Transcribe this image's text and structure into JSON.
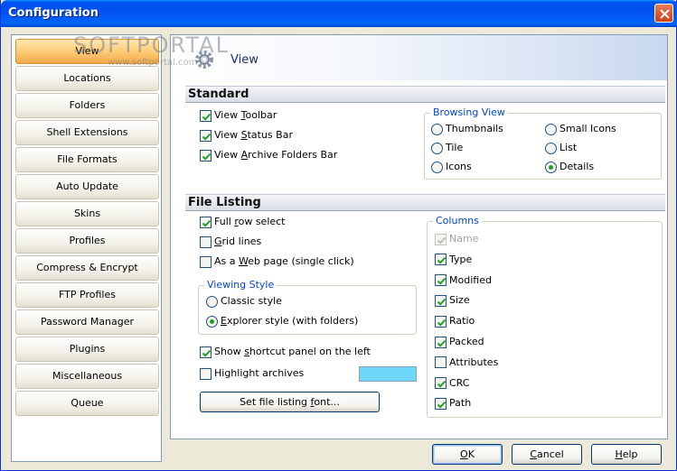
{
  "window": {
    "title": "Configuration"
  },
  "watermark": {
    "main": "SOFTPORTAL",
    "sub": "www.softportal.com"
  },
  "sidebar": {
    "items": [
      {
        "label": "View",
        "active": true
      },
      {
        "label": "Locations"
      },
      {
        "label": "Folders"
      },
      {
        "label": "Shell Extensions"
      },
      {
        "label": "File Formats"
      },
      {
        "label": "Auto Update"
      },
      {
        "label": "Skins"
      },
      {
        "label": "Profiles"
      },
      {
        "label": "Compress & Encrypt"
      },
      {
        "label": "FTP Profiles"
      },
      {
        "label": "Password Manager"
      },
      {
        "label": "Plugins"
      },
      {
        "label": "Miscellaneous"
      },
      {
        "label": "Queue"
      }
    ]
  },
  "page": {
    "title": "View"
  },
  "standard": {
    "header": "Standard",
    "options": [
      {
        "pre": "View ",
        "key": "T",
        "post": "oolbar",
        "checked": true
      },
      {
        "pre": "View ",
        "key": "S",
        "post": "tatus Bar",
        "checked": true
      },
      {
        "pre": "View ",
        "key": "A",
        "post": "rchive Folders Bar",
        "checked": true
      }
    ],
    "browsing_view": {
      "legend": "Browsing View",
      "options": [
        {
          "label": "Thumbnails",
          "selected": false
        },
        {
          "label": "Small Icons",
          "selected": false
        },
        {
          "label": "Tile",
          "selected": false
        },
        {
          "label": "List",
          "selected": false
        },
        {
          "label": "Icons",
          "selected": false
        },
        {
          "label": "Details",
          "selected": true
        }
      ]
    }
  },
  "file_listing": {
    "header": "File Listing",
    "full_row": {
      "pre": "Full ",
      "key": "r",
      "post": "ow select",
      "checked": true
    },
    "grid_lines": {
      "pre": "",
      "key": "G",
      "post": "rid lines",
      "checked": false
    },
    "web_page": {
      "pre": "As a ",
      "key": "W",
      "post": "eb page (single click)",
      "checked": false
    },
    "viewing_style": {
      "legend": "Viewing Style",
      "classic": {
        "label": "Classic style",
        "selected": false
      },
      "explorer": {
        "pre": "",
        "key": "E",
        "post": "xplorer style (with folders)",
        "selected": true
      }
    },
    "shortcut_panel": {
      "pre": "Show ",
      "key": "s",
      "post": "hortcut panel on the left",
      "checked": true
    },
    "highlight_archives": {
      "label": "Highlight archives",
      "checked": false,
      "color": "#6fd8f8"
    },
    "font_button": {
      "pre": "Set file listing ",
      "key": "f",
      "post": "ont..."
    },
    "columns": {
      "legend": "Columns",
      "items": [
        {
          "label": "Name",
          "checked": true,
          "disabled": true
        },
        {
          "label": "Type",
          "checked": true
        },
        {
          "label": "Modified",
          "checked": true
        },
        {
          "label": "Size",
          "checked": true
        },
        {
          "label": "Ratio",
          "checked": true
        },
        {
          "label": "Packed",
          "checked": true
        },
        {
          "label": "Attributes",
          "checked": false
        },
        {
          "label": "CRC",
          "checked": true
        },
        {
          "label": "Path",
          "checked": true
        }
      ]
    }
  },
  "buttons": {
    "ok": {
      "key": "O",
      "post": "K"
    },
    "cancel": {
      "key": "C",
      "post": "ancel"
    },
    "help": {
      "key": "H",
      "post": "elp"
    }
  }
}
